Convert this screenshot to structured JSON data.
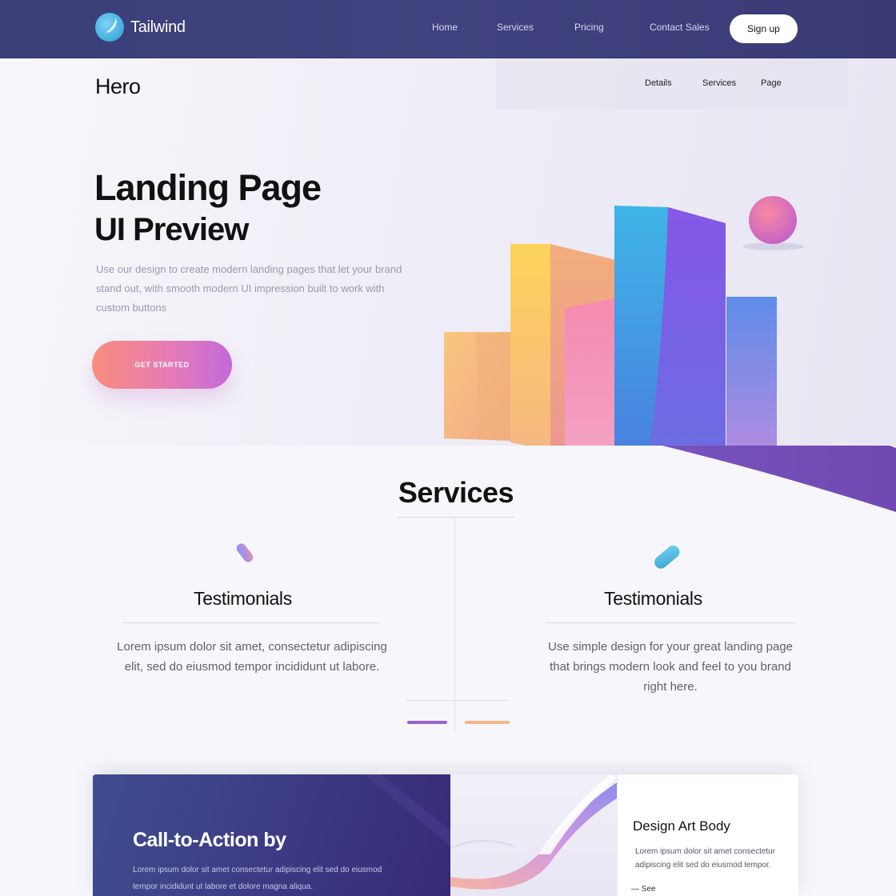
{
  "nav": {
    "logo_text": "Tailwind",
    "links": [
      "Home",
      "Services",
      "Pricing",
      "Contact Sales"
    ],
    "cta_label": "Sign up"
  },
  "hero": {
    "label": "Hero",
    "sublinks": [
      "Details",
      "Services",
      "Page"
    ],
    "title": "Landing Page",
    "subtitle": "UI Preview",
    "description": "Use our design to create modern landing pages that let your brand stand out, with smooth modern UI impression built to work with custom buttons",
    "button_label": "GET STARTED"
  },
  "services": {
    "title": "Services",
    "cards": [
      {
        "title": "Testimonials",
        "text": "Lorem ipsum dolor sit amet, consectetur adipiscing elit, sed do eiusmod tempor incididunt ut labore."
      },
      {
        "title": "Testimonials",
        "text": "Use simple design for your great landing page that brings modern look and feel to you brand right here."
      }
    ]
  },
  "cta": {
    "title": "Call-to-Action by",
    "description": "Lorem ipsum dolor sit amet consectetur adipiscing elit sed do eiusmod tempor incididunt ut labore et dolore magna aliqua.",
    "card_title": "Design Art Body",
    "card_text": "Lorem ipsum dolor sit amet consectetur adipiscing elit sed do eiusmod tempor.",
    "card_link": "— See"
  },
  "colors": {
    "nav_bg": "#3b3f78",
    "accent_pink": "#e77bb5",
    "accent_purple": "#9a62d6",
    "accent_orange": "#f2b68a",
    "accent_blue": "#47b2e0"
  }
}
